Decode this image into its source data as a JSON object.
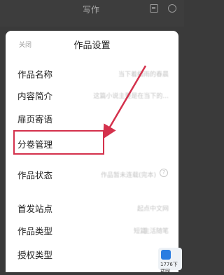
{
  "topbar": {
    "title": "写作",
    "icons": [
      "list-icon",
      "info-icon"
    ]
  },
  "sheet": {
    "close_label": "关闭",
    "title": "作品设置",
    "rows": [
      {
        "label": "作品名称",
        "value": "当下着细雨的春晨"
      },
      {
        "label": "内容简介",
        "value": "这篇小说主要是在当下的..."
      },
      {
        "label": "扉页寄语",
        "value": ""
      },
      {
        "label": "分卷管理",
        "value": ""
      },
      {
        "label": "作品状态",
        "value": "作品暂未连载(完本)"
      },
      {
        "label": "首发站点",
        "value": "起点中文网"
      },
      {
        "label": "作品类型",
        "value": "短篇",
        "value2": "生活随笔"
      },
      {
        "label": "授权类型",
        "value": ""
      }
    ]
  },
  "annotation": {
    "highlight_color": "#d4314c",
    "target": "分卷管理"
  },
  "watermark": {
    "text": "1776下载网"
  }
}
